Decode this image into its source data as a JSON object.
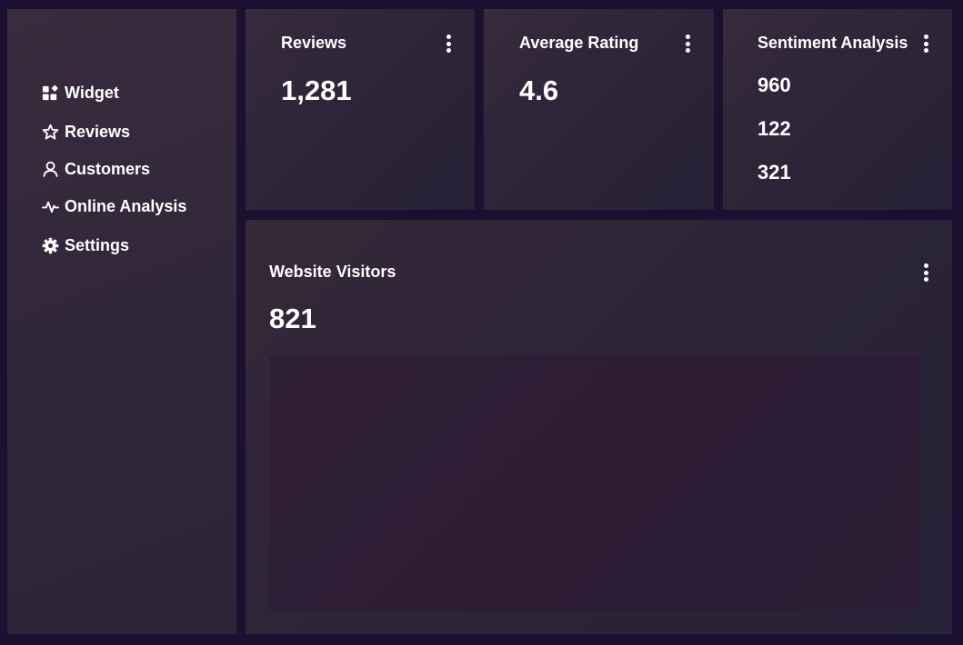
{
  "sidebar": {
    "items": [
      {
        "label": "Widget",
        "icon": "widget-icon"
      },
      {
        "label": "Reviews",
        "icon": "star-icon"
      },
      {
        "label": "Customers",
        "icon": "user-icon"
      },
      {
        "label": "Online Analysis",
        "icon": "activity-icon"
      },
      {
        "label": "Settings",
        "icon": "gear-icon"
      }
    ]
  },
  "cards": {
    "reviews": {
      "title": "Reviews",
      "value": "1,281"
    },
    "rating": {
      "title": "Average Rating",
      "value": "4.6"
    },
    "sentiment": {
      "title": "Sentiment Analysis",
      "values": [
        "960",
        "122",
        "321"
      ]
    },
    "visitors": {
      "title": "Website Visitors",
      "value": "821"
    }
  },
  "colors": {
    "page_background": "#1c1030",
    "panel": "#2f2639",
    "chart_area": "#2e1c35",
    "text": "#ffffff"
  }
}
